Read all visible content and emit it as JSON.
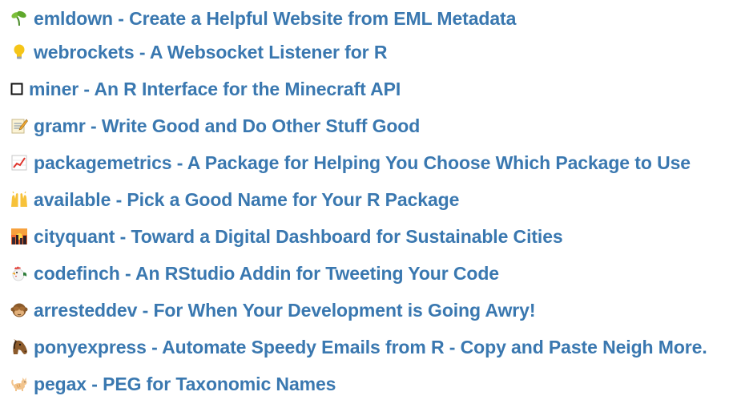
{
  "packages": [
    {
      "icon": "seedling-icon",
      "name": "emldown",
      "description": "Create a Helpful Website from EML Metadata"
    },
    {
      "icon": "lightbulb-icon",
      "name": "webrockets",
      "description": "A Websocket Listener for R"
    },
    {
      "icon": "white-square-icon",
      "name": "miner",
      "description": "An R Interface for the Minecraft API"
    },
    {
      "icon": "memo-icon",
      "name": "gramr",
      "description": "Write Good and Do Other Stuff Good"
    },
    {
      "icon": "chart-increasing-icon",
      "name": "packagemetrics",
      "description": "A Package for Helping You Choose Which Package to Use"
    },
    {
      "icon": "raising-hands-icon",
      "name": "available",
      "description": "Pick a Good Name for Your R Package"
    },
    {
      "icon": "sunset-city-icon",
      "name": "cityquant",
      "description": "Toward a Digital Dashboard for Sustainable Cities"
    },
    {
      "icon": "rooster-icon",
      "name": "codefinch",
      "description": "An RStudio Addin for Tweeting Your Code"
    },
    {
      "icon": "see-no-evil-monkey-icon",
      "name": "arresteddev",
      "description": "For When Your Development is Going Awry!"
    },
    {
      "icon": "horse-face-icon",
      "name": "ponyexpress",
      "description": "Automate Speedy Emails from R - Copy and Paste Neigh More."
    },
    {
      "icon": "cat-icon",
      "name": "pegax",
      "description": "PEG for Taxonomic Names"
    }
  ],
  "separator": " - ",
  "colors": {
    "link": "#3a78b0",
    "background": "#ffffff"
  }
}
